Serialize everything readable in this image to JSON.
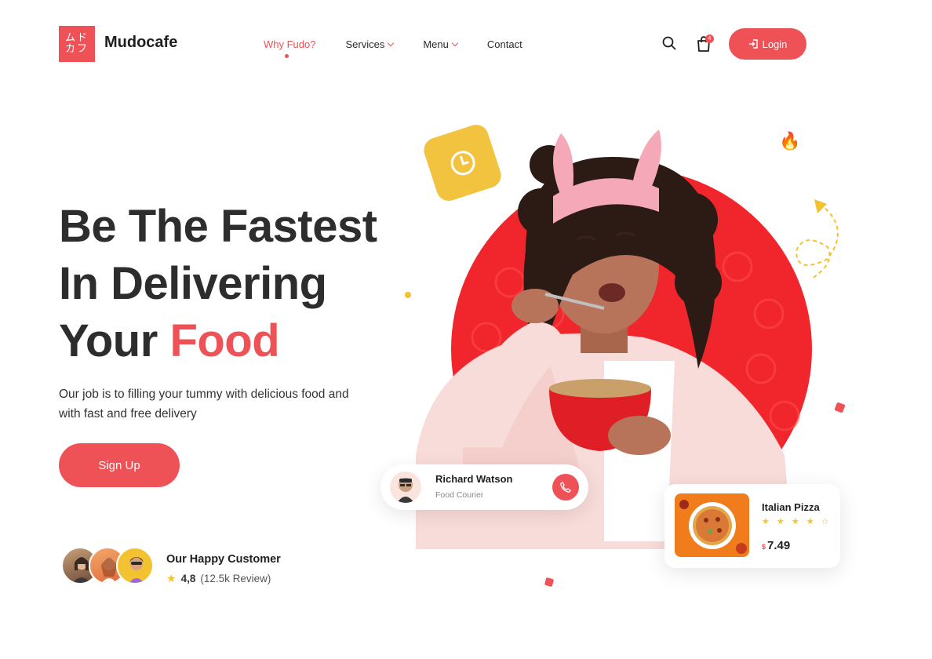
{
  "brand": {
    "logo_glyphs": "ムド\nカフ",
    "name": "Mudocafe"
  },
  "nav": {
    "items": [
      {
        "label": "Why Fudo?",
        "active": true
      },
      {
        "label": "Services",
        "dropdown": true
      },
      {
        "label": "Menu",
        "dropdown": true
      },
      {
        "label": "Contact"
      }
    ],
    "cart_count": "4",
    "login_label": "Login"
  },
  "hero": {
    "title_line1": "Be The Fastest",
    "title_line2": "In Delivering",
    "title_line3_plain": "Your ",
    "title_line3_accent": "Food",
    "subtitle": "Our job is to filling your tummy with delicious food and  with fast and free delivery",
    "signup_label": "Sign Up"
  },
  "customers": {
    "title": "Our Happy Customer",
    "rating": "4,8",
    "reviews": "(12.5k Review)"
  },
  "courier": {
    "name": "Richard Watson",
    "role": "Food Courier"
  },
  "product": {
    "name": "Italian Pizza",
    "stars": "★ ★ ★ ★ ☆",
    "rating": 4,
    "currency": "$",
    "price": "7.49"
  },
  "colors": {
    "accent": "#ee5257",
    "yellow": "#f2c33f",
    "text": "#2d2d2d"
  },
  "icons": [
    "search-icon",
    "shopping-bag-icon",
    "login-icon",
    "clock-icon",
    "fire-icon",
    "phone-icon",
    "star-icon"
  ]
}
